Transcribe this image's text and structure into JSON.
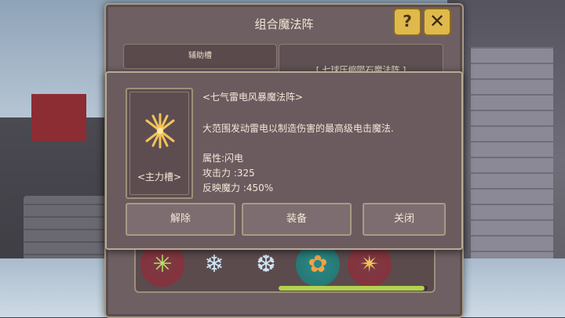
{
  "window": {
    "title": "组合魔法阵",
    "help_label": "?",
    "close_label": "✕",
    "tab_aux": "辅助槽",
    "tab_formation": "[ 七球压缩陨石魔法阵 ]"
  },
  "popup": {
    "skill_name": "<七气雷电风暴魔法阵>",
    "description": "大范围发动雷电以制造伤害的最高级电击魔法.",
    "attribute": "属性:闪电",
    "attack": "攻击力 :325",
    "reflect": "反映魔力 :450%",
    "slot_label": "<主力槽>",
    "buttons": {
      "unequip": "解除",
      "equip": "装备",
      "close": "关闭"
    }
  },
  "gems": [
    {
      "icon": "green-lightning-gem-icon",
      "glyph": "✳"
    },
    {
      "icon": "ice-flower-gem-icon",
      "glyph": "❄"
    },
    {
      "icon": "ice-star-gem-icon",
      "glyph": "❆"
    },
    {
      "icon": "fire-flower-gem-icon",
      "glyph": "✿"
    },
    {
      "icon": "lightning-gem-icon",
      "glyph": "✴"
    }
  ],
  "progress": 0.98,
  "colors": {
    "accent_gold": "#e0b94c",
    "panel": "#6b5b5f",
    "text": "#f1e8d6",
    "progress": "#b3d34b"
  }
}
